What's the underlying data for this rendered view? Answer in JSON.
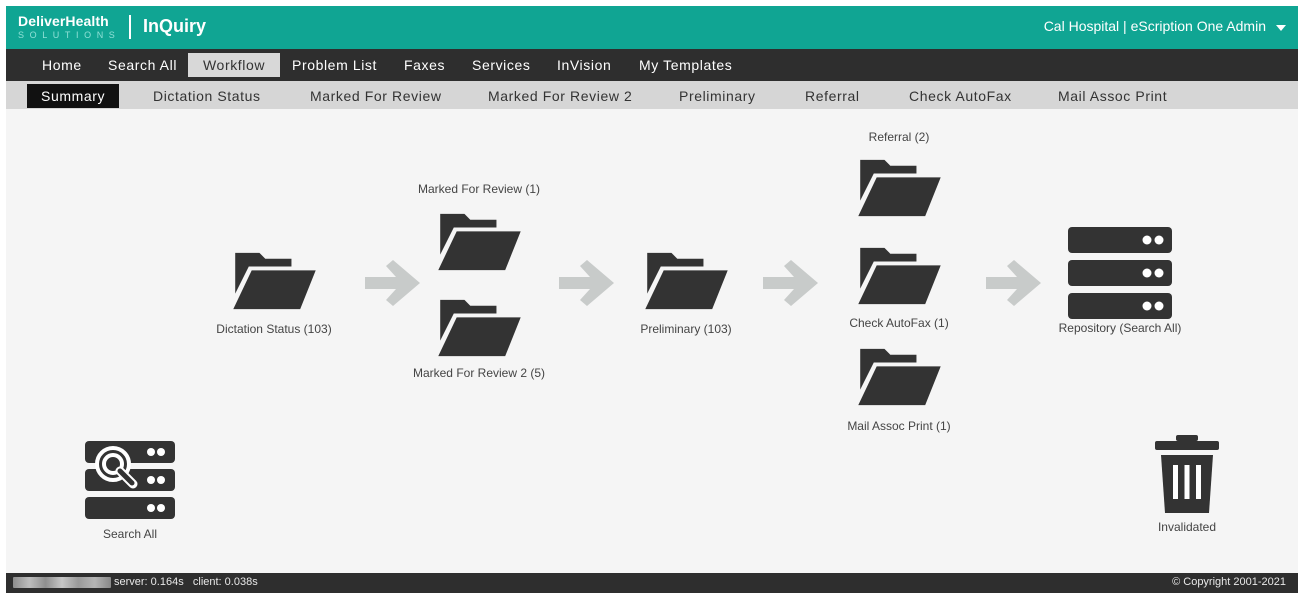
{
  "header": {
    "brand": "DeliverHealth",
    "brand_sub": "SOLUTIONS",
    "app_title": "InQuiry",
    "user_menu": "Cal Hospital | eScription One Admin"
  },
  "main_nav": {
    "items": [
      "Home",
      "Search All",
      "Workflow",
      "Problem List",
      "Faxes",
      "Services",
      "InVision",
      "My Templates"
    ],
    "active": "Workflow"
  },
  "sub_nav": {
    "items": [
      "Summary",
      "Dictation Status",
      "Marked For Review",
      "Marked For Review 2",
      "Preliminary",
      "Referral",
      "Check AutoFax",
      "Mail Assoc Print"
    ],
    "active": "Summary"
  },
  "workflow": {
    "dictation_status": "Dictation Status (103)",
    "marked_for_review": "Marked For Review (1)",
    "marked_for_review_2": "Marked For Review 2 (5)",
    "preliminary": "Preliminary (103)",
    "referral": "Referral (2)",
    "check_autofax": "Check AutoFax (1)",
    "mail_assoc_print": "Mail Assoc Print (1)",
    "repository": "Repository (Search All)",
    "search_all": "Search All",
    "invalidated": "Invalidated"
  },
  "footer": {
    "timing": "server: 0.164s   client: 0.038s",
    "copyright": "© Copyright 2001-2021"
  },
  "icons": {
    "folder": "folder-open-icon",
    "arrow": "arrow-right-icon",
    "repository": "server-stack-icon",
    "search_all": "server-search-icon",
    "trash": "trash-icon",
    "caret": "chevron-down-icon"
  },
  "colors": {
    "header": "#10a593",
    "nav": "#2e2e2e",
    "subnav": "#d6d6d6",
    "icon": "#333333",
    "arrow": "#c8cbca"
  }
}
